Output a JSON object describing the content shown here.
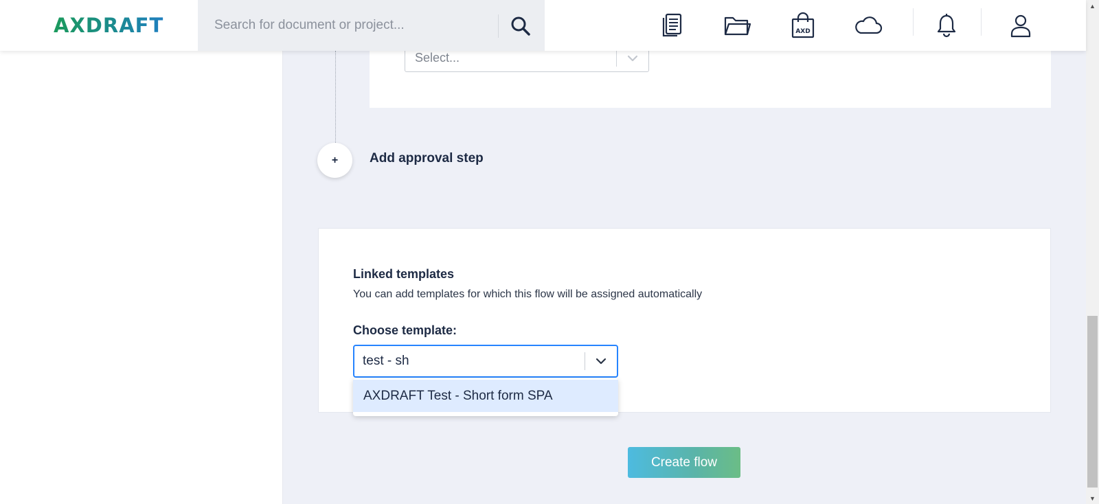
{
  "brand": {
    "logo_text": "AXDRAFT",
    "gradient": [
      "#1b9a5c",
      "#1f7fc0"
    ]
  },
  "search": {
    "placeholder": "Search for document or project..."
  },
  "nav_icons": [
    "documents-icon",
    "folder-icon",
    "axd-marketplace-icon",
    "cloud-icon",
    "bell-icon",
    "user-icon"
  ],
  "marketplace_icon_text": "AXD",
  "approval": {
    "select_placeholder": "Select...",
    "add_step_symbol": "+",
    "add_step_label": "Add approval step"
  },
  "linked_templates": {
    "title": "Linked templates",
    "description": "You can add templates for which this flow will be assigned automatically",
    "choose_label": "Choose template:",
    "input_value": "test - sh",
    "options": [
      "AXDRAFT Test - Short form SPA"
    ]
  },
  "actions": {
    "create_flow_label": "Create flow"
  },
  "colors": {
    "accent": "#2684ff",
    "option_highlight": "#deebff",
    "background": "#eef0f7"
  }
}
